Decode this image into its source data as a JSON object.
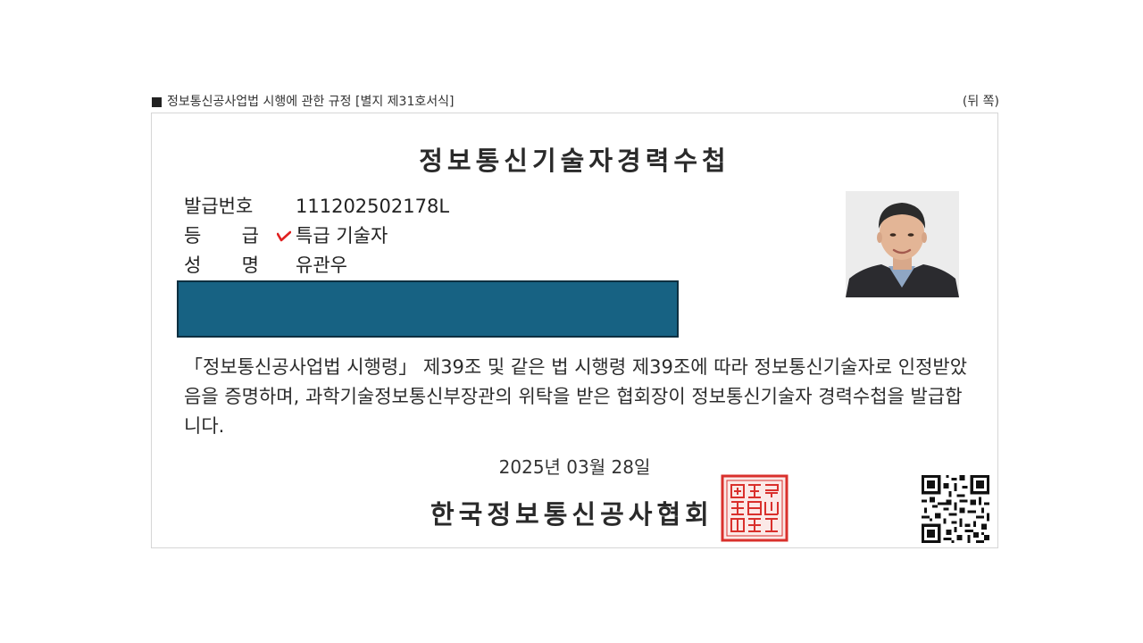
{
  "header": {
    "form_source": "정보통신공사업법 시행에 관한 규정 [별지 제31호서식]",
    "side_label": "(뒤 쪽)"
  },
  "certificate": {
    "title": "정보통신기술자경력수첩",
    "fields": [
      {
        "label_parts": [
          "발급번호"
        ],
        "value": "111202502178L"
      },
      {
        "label_parts": [
          "등",
          "급"
        ],
        "value": "특급 기술자"
      },
      {
        "label_parts": [
          "성",
          "명"
        ],
        "value": "유관우"
      }
    ],
    "statement": "「정보통신공사업법 시행령」 제39조 및 같은 법 시행령 제39조에 따라 정보통신기술자로 인정받았음을 증명하며, 과학기술정보통신부장관의 위탁을 받은 협회장이 정보통신기술자 경력수첩을 발급합니다.",
    "issue_date": "2025년 03월 28일",
    "issuer": "한국정보통신공사협회"
  },
  "colors": {
    "redaction": "#176283",
    "seal": "#d9302c",
    "check_mark": "#e02020"
  },
  "icons": {
    "check": "check-mark-icon",
    "seal": "official-seal",
    "qr": "qr-code"
  }
}
